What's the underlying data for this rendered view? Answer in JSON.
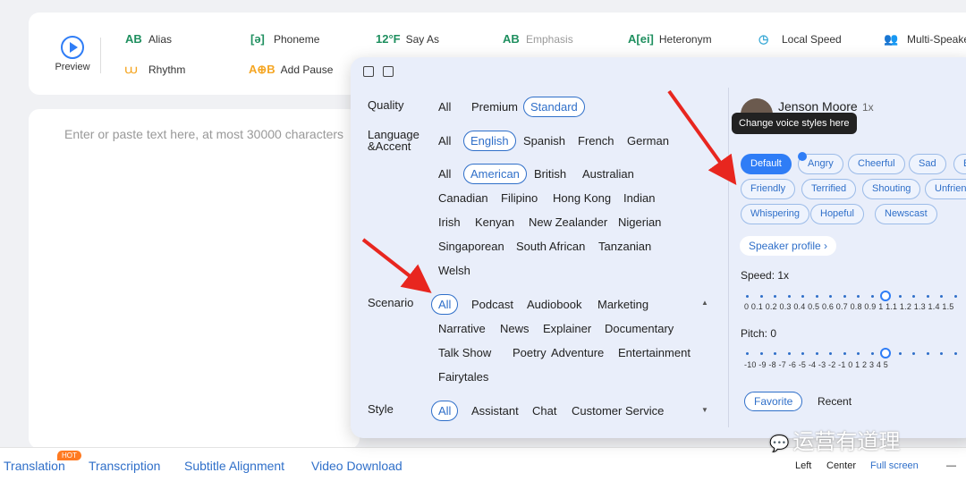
{
  "toolbar": {
    "preview": "Preview",
    "tools": [
      {
        "icon": "AB",
        "label": "Alias",
        "color": "#1f8f5f"
      },
      {
        "icon": "[ə]",
        "label": "Phoneme",
        "color": "#1f8f5f"
      },
      {
        "icon": "12°F",
        "label": "Say As",
        "color": "#1f8f5f"
      },
      {
        "icon": "AB",
        "label": "Emphasis",
        "color": "#1f8f5f"
      },
      {
        "icon": "A[ei]",
        "label": "Heteronym",
        "color": "#1f8f5f"
      },
      {
        "icon": "◷",
        "label": "Local Speed",
        "color": "#3aa9d6"
      },
      {
        "icon": "👥",
        "label": "Multi-Speake",
        "color": "#3aa9d6"
      },
      {
        "icon": "⩊",
        "label": "Rhythm",
        "color": "#f5a623"
      },
      {
        "icon": "A⊕B",
        "label": "Add Pause",
        "color": "#f5a623"
      }
    ]
  },
  "editor": {
    "placeholder": "Enter or paste text here, at most 30000 characters"
  },
  "bottom": {
    "tabs": [
      "Translation",
      "Transcription",
      "Subtitle Alignment",
      "Video Download"
    ],
    "hot": "HOT",
    "align": [
      "Left",
      "Center",
      "Full screen"
    ],
    "minimize": "—"
  },
  "filters": {
    "quality": {
      "label": "Quality",
      "options": [
        "All",
        "Premium",
        "Standard"
      ],
      "selected": "Standard"
    },
    "language": {
      "label": "Language &Accent",
      "row1": [
        "All",
        "English",
        "Spanish",
        "French",
        "German"
      ],
      "selected": "English"
    },
    "accents": {
      "row1": [
        "All",
        "American",
        "British",
        "Australian"
      ],
      "selected": "American",
      "row2": [
        "Canadian",
        "Filipino",
        "Hong Kong",
        "Indian"
      ],
      "row3": [
        "Irish",
        "Kenyan",
        "New Zealander",
        "Nigerian"
      ],
      "row4": [
        "Singaporean",
        "South African",
        "Tanzanian"
      ],
      "row5": [
        "Welsh"
      ]
    },
    "scenario": {
      "label": "Scenario",
      "row1": [
        "All",
        "Podcast",
        "Audiobook",
        "Marketing"
      ],
      "selected": "All",
      "row2": [
        "Narrative",
        "News",
        "Explainer",
        "Documentary"
      ],
      "row3": [
        "Talk Show",
        "Poetry",
        "Adventure",
        "Entertainment"
      ],
      "row4": [
        "Fairytales"
      ]
    },
    "style": {
      "label": "Style",
      "options": [
        "All",
        "Assistant",
        "Chat",
        "Customer Service"
      ],
      "selected": "All"
    }
  },
  "voice": {
    "name": "Jenson Moore",
    "count": "1x",
    "tooltip": "Change voice styles here",
    "styles_row1": [
      "Default",
      "Angry",
      "Cheerful",
      "Sad",
      "E"
    ],
    "styles_row2": [
      "Friendly",
      "Terrified",
      "Shouting",
      "Unfrien"
    ],
    "styles_row3": [
      "Whispering",
      "Hopeful",
      "Newscast"
    ],
    "selected_style": "Default",
    "profile": "Speaker profile ›",
    "speed_label": "Speed:  1x",
    "speed_scale": "0  0.1 0.2 0.3 0.4 0.5 0.6 0.7 0.8 0.9  1  1.1 1.2 1.3 1.4 1.5",
    "speed_value_index": 10,
    "pitch_label": "Pitch:  0",
    "pitch_scale": "-10 -9  -8  -7  -6  -5  -4  -3  -2  -1   0   1   2   3   4   5",
    "pitch_value_index": 10,
    "favorite": "Favorite",
    "recent": "Recent"
  },
  "watermark": "运营有道理",
  "colors": {
    "accent": "#2f7df6",
    "arrow": "#e8261f",
    "link": "#2f6fc9"
  }
}
